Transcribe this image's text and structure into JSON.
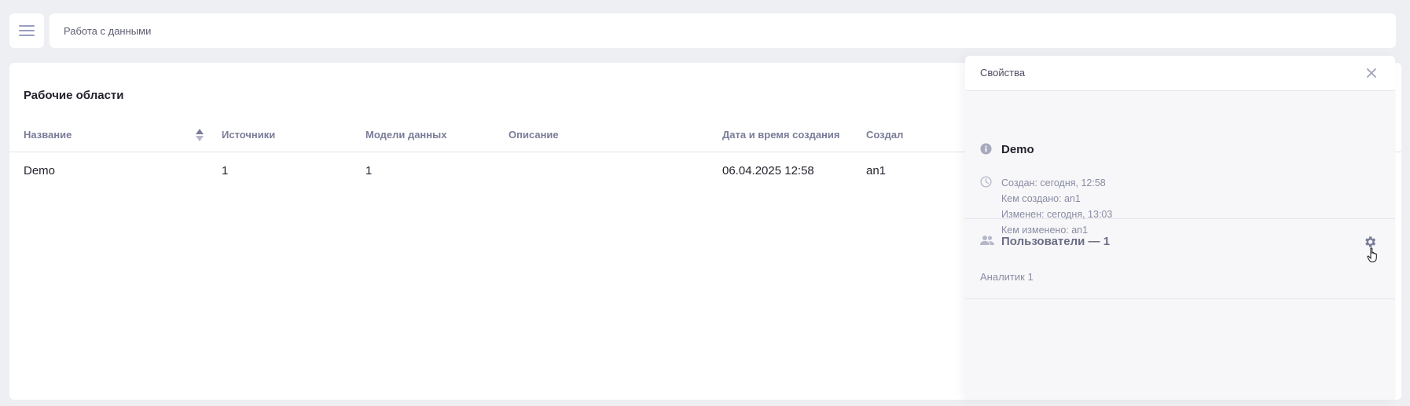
{
  "header": {
    "menu_icon": "hamburger-icon",
    "breadcrumb": "Работа с данными"
  },
  "workspaces": {
    "title": "Рабочие области",
    "columns": [
      "Название",
      "Источники",
      "Модели данных",
      "Описание",
      "Дата и время создания",
      "Создал"
    ],
    "rows": [
      {
        "name": "Demo",
        "sources": "1",
        "models": "1",
        "description": "",
        "created_at": "06.04.2025 12:58",
        "author": "an1"
      }
    ]
  },
  "properties": {
    "title": "Свойства",
    "name": "Demo",
    "meta": {
      "created": "Создан: сегодня, 12:58",
      "created_by": "Кем создано: an1",
      "modified": "Изменен: сегодня, 13:03",
      "modified_by": "Кем изменено: an1"
    },
    "users": {
      "title": "Пользователи — 1",
      "items": [
        "Аналитик 1"
      ]
    }
  },
  "colors": {
    "accent": "#7a7c98",
    "icon": "#a7a9bd"
  }
}
